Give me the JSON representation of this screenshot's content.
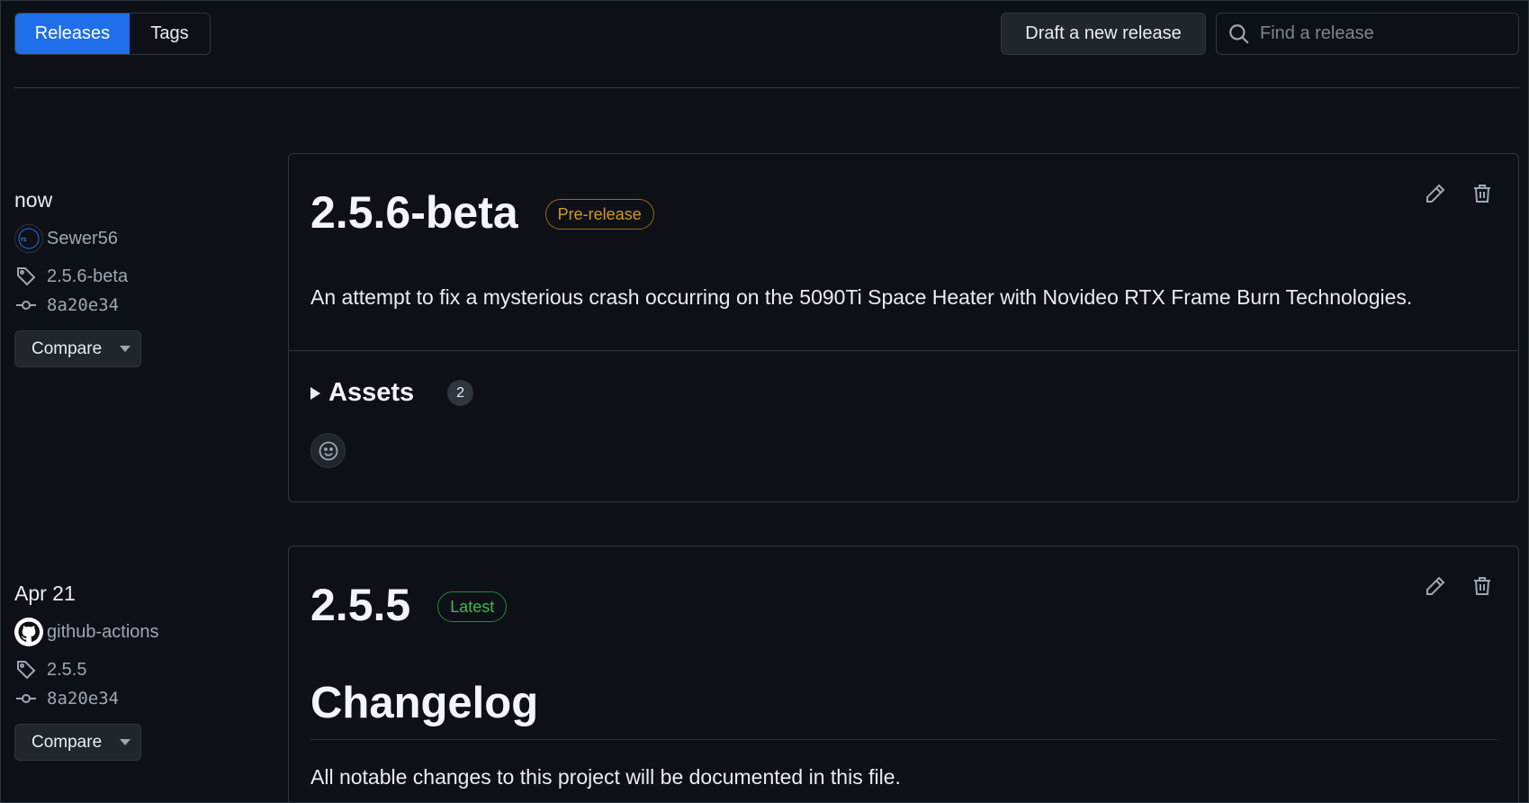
{
  "toolbar": {
    "releases_tab": "Releases",
    "tags_tab": "Tags",
    "draft_button": "Draft a new release",
    "search_placeholder": "Find a release"
  },
  "releases": [
    {
      "when": "now",
      "author": "Sewer56",
      "tag": "2.5.6-beta",
      "commit": "8a20e34",
      "compare_label": "Compare",
      "title": "2.5.6-beta",
      "badge": "Pre-release",
      "description": "An attempt to fix a mysterious crash occurring on the 5090Ti Space Heater with Novideo RTX Frame Burn Technologies.",
      "assets_label": "Assets",
      "assets_count": "2"
    },
    {
      "when": "Apr 21",
      "author": "github-actions",
      "tag": "2.5.5",
      "commit": "8a20e34",
      "compare_label": "Compare",
      "title": "2.5.5",
      "badge": "Latest",
      "heading": "Changelog",
      "description": "All notable changes to this project will be documented in this file."
    }
  ],
  "colors": {
    "accent": "#1f6feb",
    "prerelease": "#d29922",
    "latest": "#3fb950",
    "background": "#0d1117"
  }
}
